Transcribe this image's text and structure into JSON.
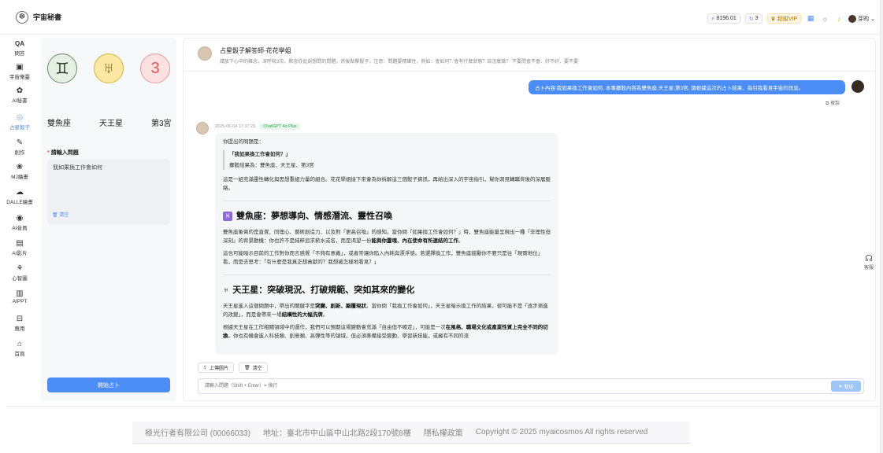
{
  "app": {
    "title": "宇宙秘書"
  },
  "topbar": {
    "credits": "8196.01",
    "count": "3",
    "vip": "超級VIP",
    "user": "芽昀"
  },
  "nav": {
    "items": [
      {
        "label": "問答",
        "icon": "QA"
      },
      {
        "label": "宇宙樂靈",
        "icon": "▣"
      },
      {
        "label": "AI秘書",
        "icon": "✿"
      },
      {
        "label": "占星骰子",
        "icon": "◎"
      },
      {
        "label": "創作",
        "icon": "✎"
      },
      {
        "label": "MJ繪畫",
        "icon": "❀"
      },
      {
        "label": "DALLE繪畫",
        "icon": "☁"
      },
      {
        "label": "AI音員",
        "icon": "◉"
      },
      {
        "label": "AI影片",
        "icon": "▤"
      },
      {
        "label": "心智圖",
        "icon": "⚘"
      },
      {
        "label": "AIPPT",
        "icon": "▥"
      },
      {
        "label": "應用",
        "icon": "⊟"
      },
      {
        "label": "首頁",
        "icon": "⌂"
      }
    ]
  },
  "left_panel": {
    "signs": [
      {
        "symbol": "♊",
        "label": "雙魚座"
      },
      {
        "symbol": "♅",
        "label": "天王星"
      },
      {
        "symbol": "3",
        "label": "第3宮"
      }
    ],
    "question_label": "請輸入問題",
    "question_value": "我如果換工作會如何",
    "clear_label": "清空",
    "start_label": "開始占卜"
  },
  "chat": {
    "title": "占星骰子解答師-花花學姐",
    "subtitle": "請放下心中的雜念，深呼吸3次。默念你此刻想問的問題，然後點擊骰子。注意：問題要精確性，例如：會如何？會有什麼狀態？該怎麼做？ 不要問會不會、好不好、要不要",
    "user_message": "占卜內容:我如果換工作會如何, 本事擲骰內容為雙魚座,天王星,第3宮, 請根據這次的占卜結果，指引我看見宇宙的訊息。",
    "copy_label": "複製",
    "meta_time": "2025-06-04 17:37:23",
    "model": "ChatGPT 4o Plus",
    "answer": {
      "intro": "你提出的問題是：",
      "quote_q": "「我如果換工作會如何？」",
      "quote_r": "擲骰結果為：雙魚座、天王星、第3宮",
      "p1": "這是一組充滿靈性轉化與思想重組力量的組合。花花學姐接下來會為你拆解這三個骰子資訊，再給出深入的宇宙指引，幫你洞見轉職背後的深層脈絡。",
      "h1_icon": "♓",
      "h1": "雙魚座：夢想導向、情感潛流、靈性召喚",
      "p2a": "雙魚座象徵的是直覺、同理心、藝術創造力、以及對「更高召喚」的感知。當你問「如果換工作會如何？」時，雙魚座能量呈現出一種「非理性但深刻」的背景動機：你也許不是純粹追求薪水或名，而是渴望一份",
      "p2b": "能與你靈魂、內在使命有所連結的工作",
      "p2c": "。",
      "p3": "這也可能暗示目前的工作對你而言感覺「不夠有意義」，或者常讓你陷入內耗與漂浮感。若選擇換工作，雙魚座鼓勵你不要只是往「現實地位」看，而是去思考：「有什麼是我真正想貢獻的？我想被怎樣地看見？」",
      "h2_icon": "♅",
      "h2": "天王星：突破現況、打破規範、突如其來的變化",
      "p4a": "天王星進入這個問題中，帶出的關鍵字是",
      "p4b": "突變、創新、顛覆現狀",
      "p4c": "。當你問「我換工作會如何」，天王星暗示換工作的結果，很可能不是「逐步漸進的改變」，而是會帶來一場",
      "p4d": "結構性的大幅洗牌",
      "p4e": "。",
      "p5a": "根據天王星在工作相關領域中的運作，我們可以預期這場變動會充滿「自由但不確定」，可能是一次",
      "p5b": "在風格、職場文化或產業性質上完全不同的切換",
      "p5c": "。你也有機會進入科技類、創意類、高彈性等的領域，但必須準備接受變動、學習新技能，或擁有不同的流"
    },
    "upload_label": "上傳圖片",
    "clear_label": "清空",
    "input_placeholder": "請輸入問題（Shift + Enter）= 換行",
    "send_label": "發送"
  },
  "support": {
    "label": "客服"
  },
  "footer": {
    "company": "極光行者有限公司 (00066033)",
    "address": "地址：臺北市中山區中山北路2段170號8樓",
    "privacy": "隱私權政策",
    "copyright": "Copyright © 2025 myaicosmos All rights reserved"
  },
  "colors": {
    "accent": "#4c8cf5",
    "model_tag": "#2da44e",
    "header_icon": "#8e6ad8"
  }
}
